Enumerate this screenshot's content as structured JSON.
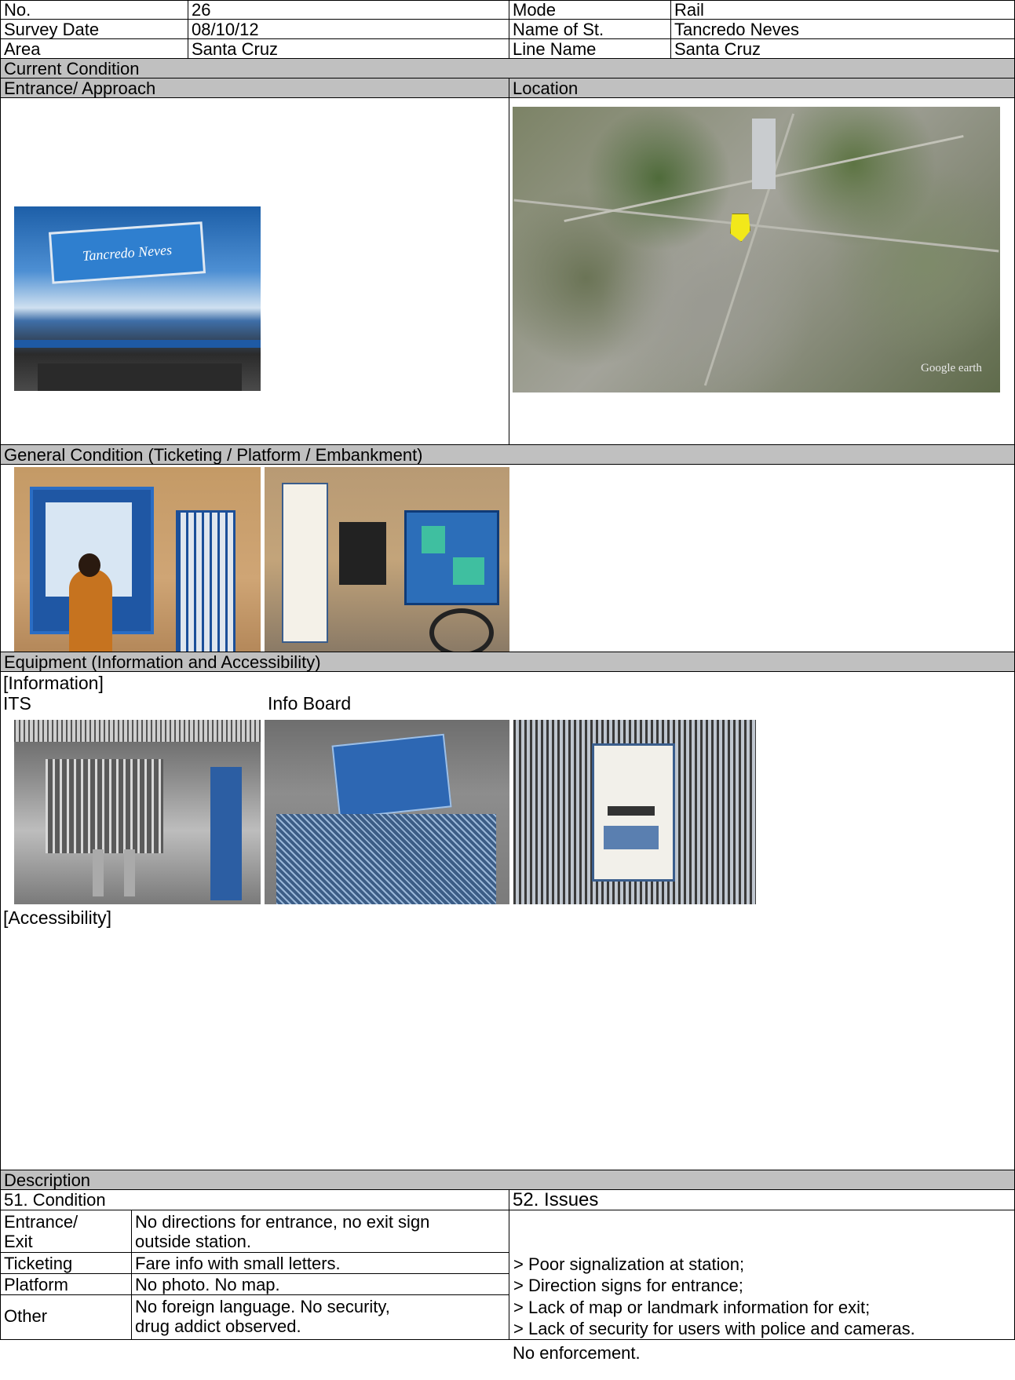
{
  "header": {
    "no_label": "No.",
    "no_value": "26",
    "mode_label": "Mode",
    "mode_value": "Rail",
    "date_label": "Survey  Date",
    "date_value": "08/10/12",
    "station_label": "Name of St.",
    "station_value": "Tancredo  Neves",
    "area_label": "Area",
    "area_value": "Santa Cruz",
    "line_label": "Line Name",
    "line_value": "Santa Cruz"
  },
  "sections": {
    "current_condition": "Current  Condition",
    "entrance": "Entrance/  Approach",
    "location": "Location",
    "general": "General  Condition  (Ticketing  / Platform  / Embankment)",
    "equipment": "Equipment  (Information   and  Accessibility)",
    "information": "[Information]",
    "its": "ITS",
    "info_board": "Info  Board",
    "accessibility": "[Accessibility]",
    "description": "Description"
  },
  "photos": {
    "entrance_sign": "Tancredo Neves",
    "map_watermark": "Google earth"
  },
  "condition": {
    "title": "51.  Condition",
    "rows": [
      {
        "label": "Entrance/\nExit",
        "text": "No  directions for entrance,  no exit sign\noutside  station."
      },
      {
        "label": "Ticketing",
        "text": "Fare info with small letters."
      },
      {
        "label": "Platform",
        "text": "No  photo.  No map."
      },
      {
        "label": "Other",
        "text": "No foreign language.  No security,\ndrug addict observed."
      }
    ]
  },
  "issues": {
    "title": "52. Issues",
    "lines": [
      "> Poor signalization  at station;",
      "> Direction  signs for entrance;",
      "> Lack of map  or landmark  information  for exit;",
      "> Lack  of security  for users with police  and cameras.",
      "No enforcement."
    ]
  }
}
